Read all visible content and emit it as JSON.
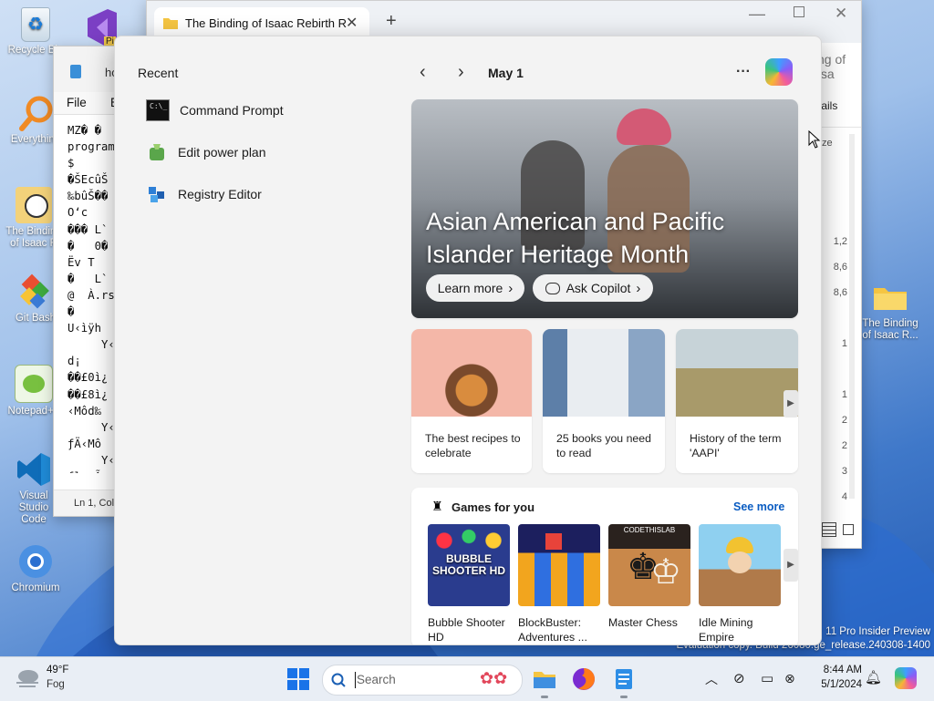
{
  "desktop": {
    "icons": [
      {
        "label": "Recycle Bin"
      },
      {
        "label": "Everything"
      },
      {
        "label": "The Binding of Isaac R"
      },
      {
        "label": "Git Bash"
      },
      {
        "label": "Notepad++"
      },
      {
        "label": "Visual Studio Code"
      },
      {
        "label": "Chromium"
      },
      {
        "label": "The Binding of Isaac R..."
      }
    ],
    "pinned_partial": "Pi",
    "watermark": {
      "line1": "11 Pro Insider Preview",
      "line2": "Evaluation copy. Build 26080.ge_release.240308-1400"
    }
  },
  "notepad": {
    "title_partial": "ho",
    "menu": {
      "file": "File",
      "edit_partial": "E"
    },
    "content_lines": [
      "MZ� �",
      "program",
      "$",
      "�ŠEcûŠ",
      "‰bûŠ��",
      "O‘c",
      "��� L`",
      "�   0�",
      "Ëv T",
      "�   L`",
      "@  À.rs",
      "�",
      "U‹ìÿh",
      "     Y‹",
      "d¡    ",
      "��£0ì¿",
      "��£8ì¿",
      "‹Môd‰",
      "     Y‹",
      "ƒÄ‹Mô",
      "     Y‹",
      "fl¡ Ã"
    ],
    "status": "Ln 1, Col"
  },
  "explorer": {
    "tab_title": "The Binding of Isaac Rebirth R",
    "addr_partial": "ng of Isa",
    "details_partial": "tails",
    "size_header_partial": "ze",
    "sizes_partial": [
      "1,2",
      "8,6",
      "8,6",
      "1",
      "1",
      "2",
      "2",
      "3",
      "4"
    ]
  },
  "panel": {
    "recent_header": "Recent",
    "recent_items": [
      {
        "label": "Command Prompt",
        "icon": "command-prompt-icon"
      },
      {
        "label": "Edit power plan",
        "icon": "power-plan-icon"
      },
      {
        "label": "Registry Editor",
        "icon": "registry-editor-icon"
      }
    ],
    "date": "May 1",
    "more": "···",
    "hero": {
      "title": "Asian American and Pacific Islander Heritage Month",
      "learn_more": "Learn more",
      "ask_copilot": "Ask Copilot"
    },
    "cards": [
      {
        "caption": "The best recipes to celebrate"
      },
      {
        "caption": "25 books you need to read"
      },
      {
        "caption": "History of the term 'AAPI'"
      }
    ],
    "games": {
      "header": "Games for you",
      "see_more": "See more",
      "items": [
        {
          "name": "Bubble Shooter HD",
          "thumb_text": "BUBBLE SHOOTER HD"
        },
        {
          "name": "BlockBuster: Adventures ...",
          "thumb_text": ""
        },
        {
          "name": "Master Chess",
          "thumb_text": "CODETHISLAB"
        },
        {
          "name": "Idle Mining Empire",
          "thumb_text": ""
        }
      ]
    }
  },
  "taskbar": {
    "weather": {
      "temp": "49°F",
      "condition": "Fog"
    },
    "search_placeholder": "Search",
    "clock": {
      "time": "8:44 AM",
      "date": "5/1/2024"
    }
  },
  "colors": {
    "accent": "#0067c0",
    "see_more": "#0a5cc2",
    "taskbar": "#e9eef5",
    "panel": "#f3f3f3"
  }
}
